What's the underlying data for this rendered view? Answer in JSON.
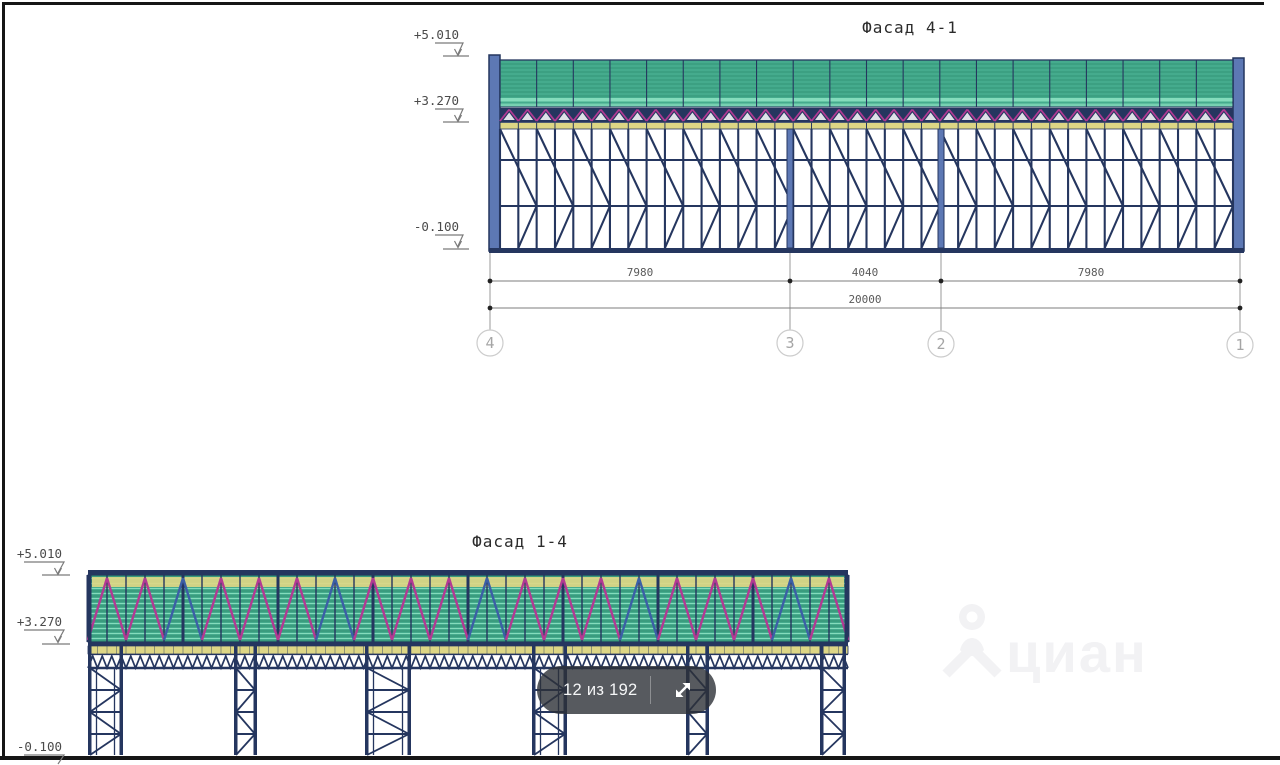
{
  "viewer": {
    "pager": {
      "label": "12 из 192"
    },
    "watermark_text": "циан"
  },
  "facade_top": {
    "title": "Фасад 4-1",
    "elevation_marks": [
      "+5.010",
      "+3.270",
      "-0.100"
    ],
    "dimension_segments": [
      "7980",
      "4040",
      "7980"
    ],
    "dimension_total": "20000",
    "grid_axes": [
      "4",
      "3",
      "2",
      "1"
    ]
  },
  "facade_bottom": {
    "title": "Фасад 1-4",
    "elevation_marks": [
      "+5.010",
      "+3.270",
      "-0.100"
    ]
  },
  "palette": {
    "steel_navy": "#25365f",
    "steel_blue_fill": "#5d78b4",
    "panel_green": "#45ab8d",
    "panel_green_dark": "#2f8e70",
    "panel_green_light": "#84dcbc",
    "band_yellow": "#ddd685",
    "truss_magenta": "#b23a93",
    "truss_blue": "#3c5fa6",
    "dim_gray": "#8a8a8a",
    "text_dark": "#2b2b2b",
    "bubble_gray": "#a5a5a5",
    "pager_bg": "rgba(45,49,55,0.8)",
    "watermark_gray": "#f2f2f4",
    "border_dark": "#161616"
  }
}
